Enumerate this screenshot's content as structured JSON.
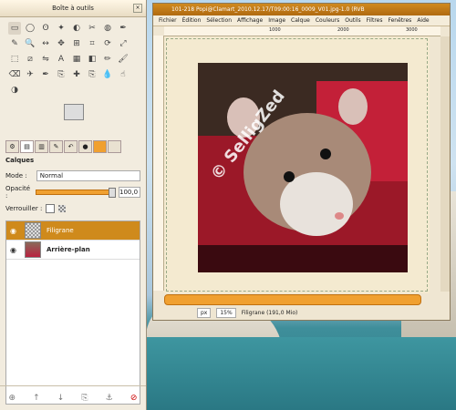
{
  "toolbox": {
    "title": "Boîte à outils",
    "tools": [
      "rect-select-icon",
      "ellipse-select-icon",
      "lasso-icon",
      "wand-icon",
      "color-select-icon",
      "scissors-icon",
      "foreground-select-icon",
      "paths-icon",
      "color-picker-icon",
      "zoom-icon",
      "measure-icon",
      "move-icon",
      "align-icon",
      "crop-icon",
      "rotate-icon",
      "scale-icon",
      "shear-icon",
      "perspective-icon",
      "flip-icon",
      "text-icon",
      "bucket-fill-icon",
      "blend-icon",
      "pencil-icon",
      "paintbrush-icon",
      "eraser-icon",
      "airbrush-icon",
      "ink-icon",
      "clone-icon",
      "heal-icon",
      "perspective-clone-icon",
      "blur-icon",
      "smudge-icon",
      "dodge-icon"
    ],
    "tool_glyphs": [
      "▭",
      "◯",
      "ʘ",
      "✦",
      "◐",
      "✂",
      "◍",
      "✒",
      "✎",
      "🔍",
      "↔",
      "✥",
      "⊞",
      "⌗",
      "⟳",
      "⤢",
      "⬚",
      "⧄",
      "⇋",
      "A",
      "▦",
      "◧",
      "✏",
      "🖌",
      "⌫",
      "✈",
      "✒",
      "⎘",
      "✚",
      "⎘",
      "💧",
      "☝",
      "◑"
    ],
    "panel_label": "Calques",
    "mode_label": "Mode :",
    "mode_value": "Normal",
    "opacity_label": "Opacité :",
    "opacity_value": "100,0",
    "lock_label": "Verrouiller :",
    "layers": [
      {
        "name": "Filigrane",
        "selected": true
      },
      {
        "name": "Arrière-plan",
        "selected": false
      }
    ]
  },
  "image_window": {
    "title": "101-218  Popi@Clamart_2010.12.17/T09:00:16_0009_V01.jpg-1.0 (RVB",
    "menu": [
      "Fichier",
      "Édition",
      "Sélection",
      "Affichage",
      "Image",
      "Calque",
      "Couleurs",
      "Outils",
      "Filtres",
      "Fenêtres",
      "Aide"
    ],
    "ruler_ticks": [
      "1000",
      "2000",
      "3000"
    ],
    "watermark": "© SelligZed",
    "unit": "px",
    "zoom": "15%",
    "status": "Filigrane (191,0 Mio)"
  }
}
